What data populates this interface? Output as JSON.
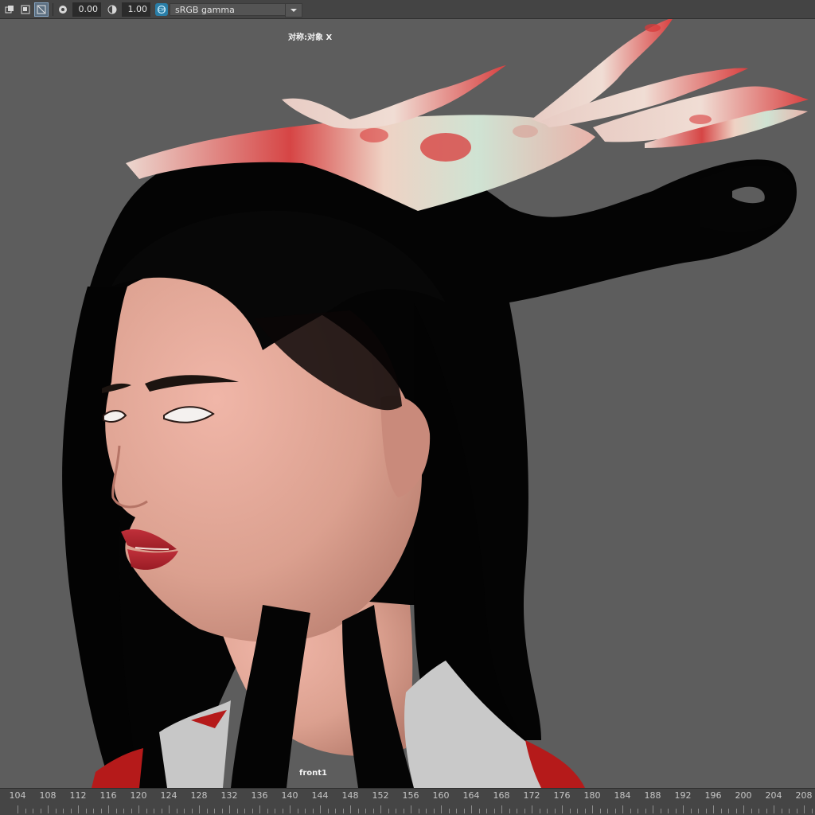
{
  "toolbar": {
    "buttons": [
      {
        "icon": "exposure-layers-icon",
        "active": false
      },
      {
        "icon": "display-overlay-icon",
        "active": false
      },
      {
        "icon": "pixel-aspect-icon",
        "active": true
      }
    ],
    "exposure_icon": "exposure-icon",
    "exposure_value": "0.00",
    "gamma_icon": "gamma-icon",
    "gamma_value": "1.00",
    "color_management_icon": "color-management-icon",
    "view_transform": "sRGB gamma",
    "dropdown_icon": "chevron-down-icon"
  },
  "viewport": {
    "hud_symmetry": "对称:对象 X",
    "camera_name": "front1"
  },
  "timeline": {
    "labels": [
      "104",
      "108",
      "112",
      "116",
      "120",
      "124",
      "128",
      "132",
      "136",
      "140",
      "144",
      "148",
      "152",
      "156",
      "160",
      "164",
      "168",
      "172",
      "176",
      "180",
      "184",
      "188",
      "192",
      "196",
      "200",
      "204",
      "208"
    ]
  },
  "colors": {
    "viewport_bg": "#5d5d5d",
    "toolbar_bg": "#444444",
    "timeline_bg": "#454545",
    "hair": "#050505",
    "skin": "#dca090",
    "lips": "#b52530",
    "ornament_red": "#d63a3a",
    "ornament_pale": "#e8d3c8"
  }
}
